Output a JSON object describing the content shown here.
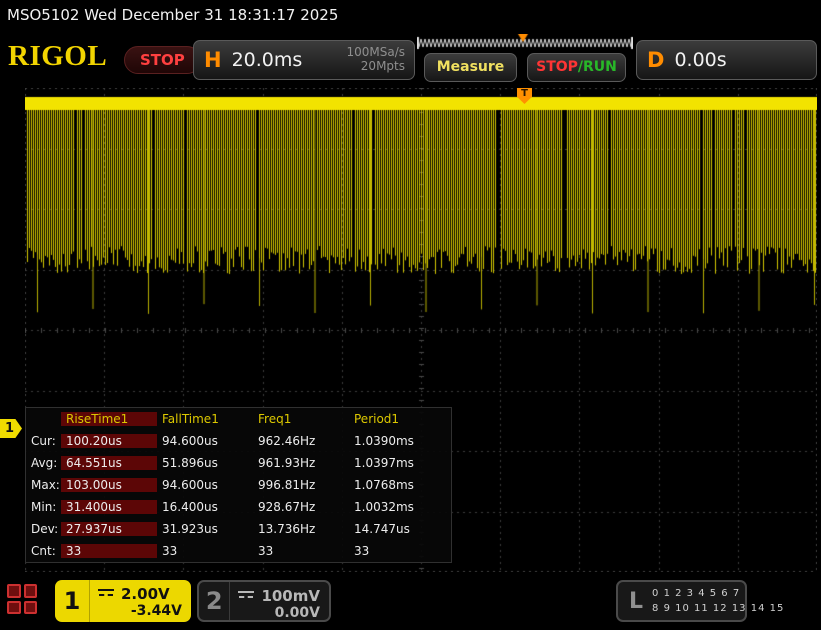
{
  "titlebar": {
    "text": "MSO5102  Wed December 31 18:31:17 2025"
  },
  "header": {
    "logo": "RIGOL",
    "run_state": "STOP",
    "h_label": "H",
    "timebase": "20.0ms",
    "sample_rate": "100MSa/s",
    "mem_depth": "20Mpts",
    "measure_label": "Measure",
    "stop_label": "STOP",
    "run_label": "/RUN",
    "d_label": "D",
    "delay": "0.00s"
  },
  "markers": {
    "trigger": "T",
    "channel1": "1"
  },
  "measurements": {
    "columns": [
      "RiseTime1",
      "FallTime1",
      "Freq1",
      "Period1"
    ],
    "rows": [
      {
        "label": "Cur:",
        "values": [
          "100.20us",
          "94.600us",
          "962.46Hz",
          "1.0390ms"
        ]
      },
      {
        "label": "Avg:",
        "values": [
          "64.551us",
          "51.896us",
          "961.93Hz",
          "1.0397ms"
        ]
      },
      {
        "label": "Max:",
        "values": [
          "103.00us",
          "94.600us",
          "996.81Hz",
          "1.0768ms"
        ]
      },
      {
        "label": "Min:",
        "values": [
          "31.400us",
          "16.400us",
          "928.67Hz",
          "1.0032ms"
        ]
      },
      {
        "label": "Dev:",
        "values": [
          "27.937us",
          "31.923us",
          "13.736Hz",
          "14.747us"
        ]
      },
      {
        "label": "Cnt:",
        "values": [
          "33",
          "33",
          "33",
          "33"
        ]
      }
    ]
  },
  "channels": {
    "ch1": {
      "number": "1",
      "scale": "2.00V",
      "offset": "-3.44V"
    },
    "ch2": {
      "number": "2",
      "scale": "100mV",
      "offset": "0.00V"
    }
  },
  "digital": {
    "label": "L",
    "row1": "0 1 2 3 4 5 6 7",
    "row2": "8 9 10 11 12 13 14 15"
  },
  "colors": {
    "channel1_yellow": "#f0dc00",
    "trigger_orange": "#ff8c00",
    "stop_red": "#ff3535",
    "run_green": "#28b828",
    "meas_highlight": "#5c0606",
    "meas_header_yellow": "#dcc800"
  }
}
